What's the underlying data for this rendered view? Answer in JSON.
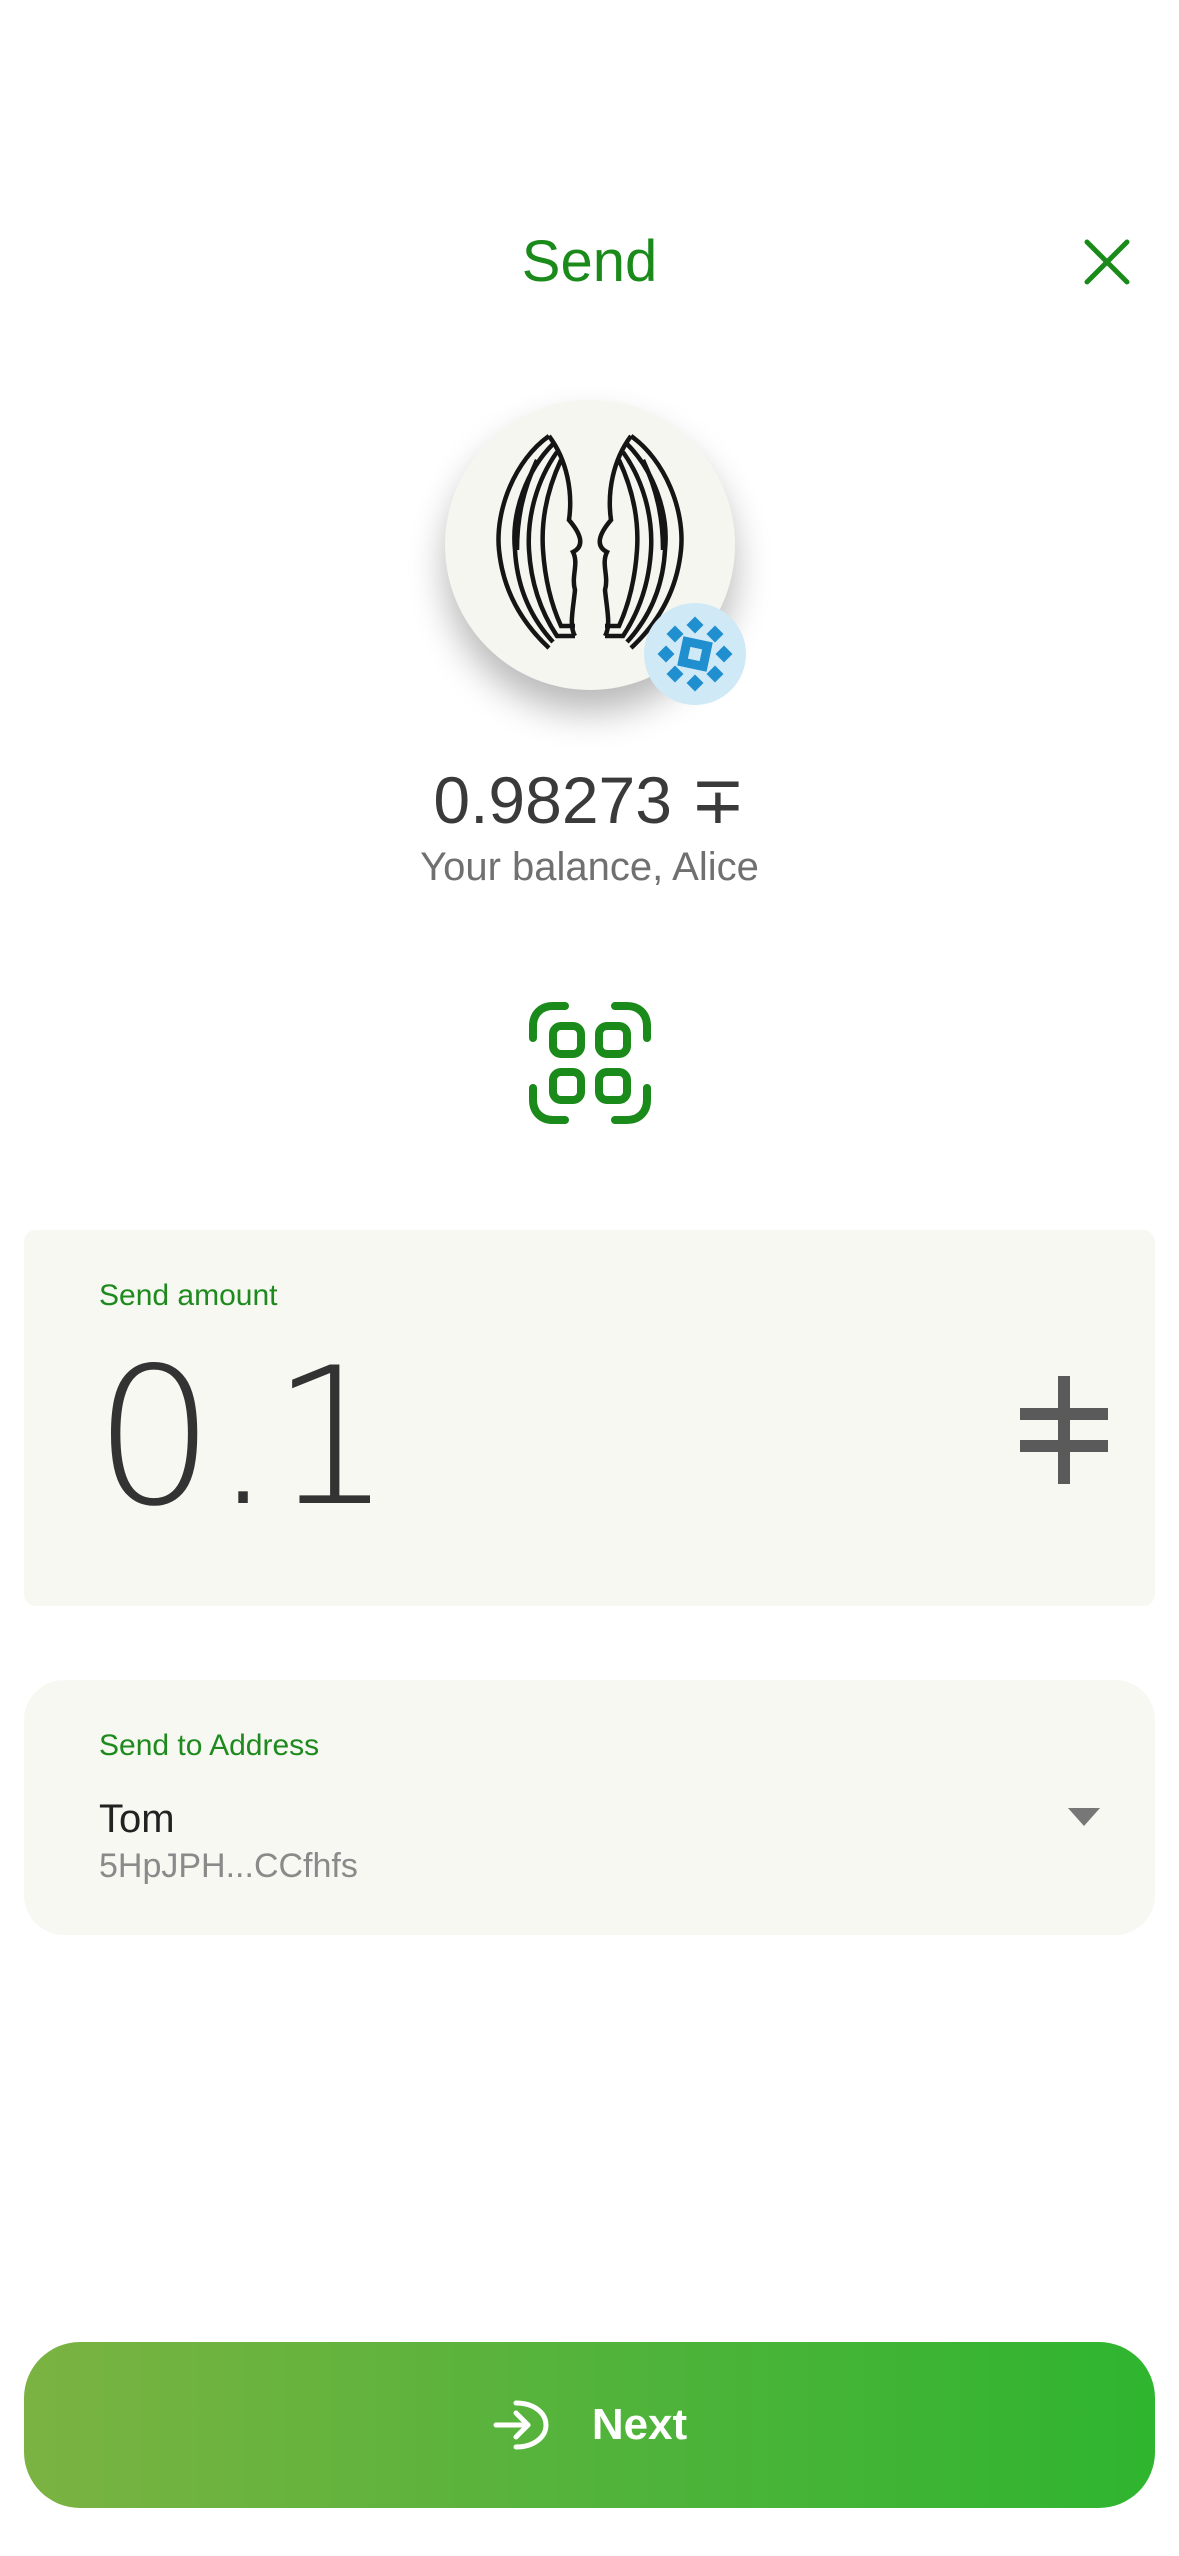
{
  "header": {
    "title": "Send",
    "close_icon": "close-icon"
  },
  "account": {
    "balance": "0.98273 ∓",
    "balance_label": "Your balance, Alice",
    "avatar_icon": "two-faces-avatar",
    "badge_icon": "network-badge-icon"
  },
  "scan": {
    "icon": "qr-scan-icon"
  },
  "amount": {
    "label": "Send amount",
    "value": "0.1",
    "currency_icon": "currency-symbol-icon"
  },
  "recipient": {
    "label": "Send to Address",
    "name": "Tom",
    "address": "5HpJPH...CCfhfs",
    "dropdown_icon": "chevron-down-icon"
  },
  "footer": {
    "next_label": "Next",
    "next_icon": "arrow-right-icon"
  },
  "colors": {
    "accent_green": "#1a8a1a",
    "card_bg": "#f6f8f1",
    "button_gradient_start": "#7bb342",
    "button_gradient_end": "#2fb52f"
  }
}
